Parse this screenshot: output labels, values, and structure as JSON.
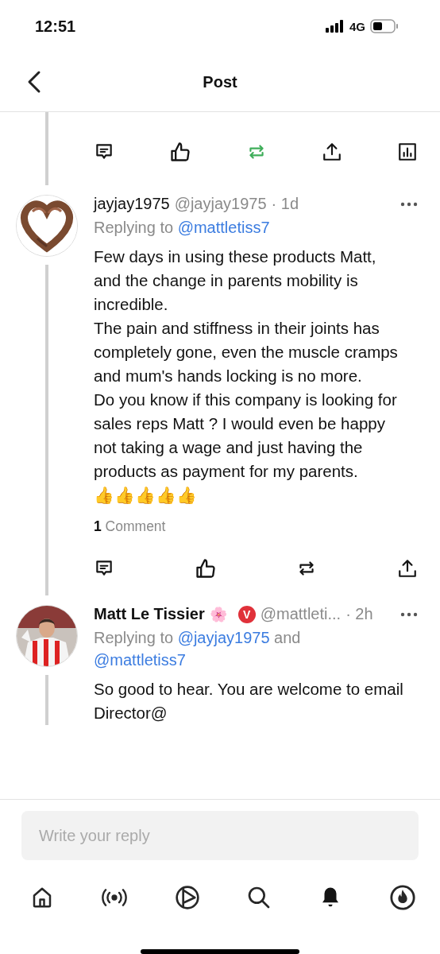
{
  "status_bar": {
    "time": "12:51",
    "network": "4G"
  },
  "header": {
    "title": "Post"
  },
  "post_actions": [
    {
      "kind": "comment",
      "active": false
    },
    {
      "kind": "like",
      "active": false
    },
    {
      "kind": "repost",
      "active": true
    },
    {
      "kind": "share",
      "active": false
    },
    {
      "kind": "stats",
      "active": false
    }
  ],
  "replies": [
    {
      "name": "jayjay1975",
      "verified": false,
      "handle": "@jayjay1975",
      "time": "· 1d",
      "replying_prefix": "Replying to",
      "replying_to": [
        "@mattletiss7"
      ],
      "body": [
        "Few days in using these products Matt,  and the change in parents mobility is incredible.",
        "The pain and stiffness in their joints has completely gone, even the muscle cramps and mum's hands locking is no more.",
        "Do you know if this company is looking for sales reps Matt ? I would even be happy not taking a wage and just having the products as payment for my parents.",
        "👍👍👍👍👍"
      ],
      "comment_count": "1",
      "comment_label": "Comment",
      "actions": [
        {
          "kind": "comment",
          "active": false
        },
        {
          "kind": "like",
          "active": false
        },
        {
          "kind": "repost",
          "active": false
        },
        {
          "kind": "share",
          "active": false
        }
      ]
    },
    {
      "name": "Matt Le Tissier",
      "name_emoji": "🌸",
      "verified": true,
      "badge": "V",
      "handle": "@mattleti...",
      "time": "· 2h",
      "replying_prefix": "Replying to",
      "replying_to": [
        "@jayjay1975",
        "@mattletiss7"
      ],
      "replying_joiner": "and",
      "body": [
        "So good to hear. You are welcome to email Director@"
      ]
    }
  ],
  "composer": {
    "placeholder": "Write your reply"
  },
  "tab_bar": [
    {
      "kind": "home",
      "selected": false
    },
    {
      "kind": "live",
      "selected": false
    },
    {
      "kind": "play",
      "selected": false
    },
    {
      "kind": "search",
      "selected": false
    },
    {
      "kind": "bell",
      "selected": true
    },
    {
      "kind": "flame",
      "selected": false
    }
  ]
}
